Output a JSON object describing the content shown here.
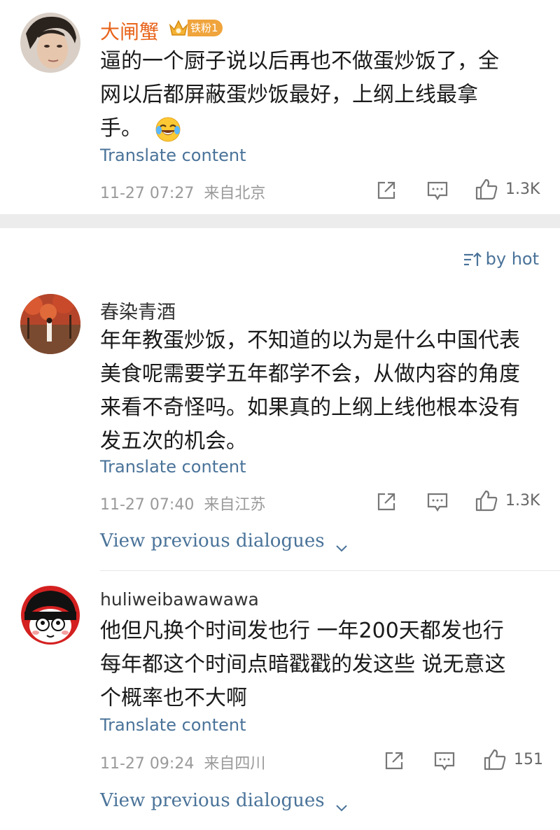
{
  "colors": {
    "link": "#4a7399",
    "username_orange": "#e8641b",
    "meta": "#9a9a9a",
    "gap": "#ececec"
  },
  "top_comment": {
    "username": "大闸蟹",
    "badge_icon": "crown-fan-icon",
    "badge_label": "铁粉1",
    "lines": [
      "逼的一个厨子说以后再也不做蛋炒饭了，全",
      "网以后都屏蔽蛋炒饭最好，上纲上线最拿",
      "手。"
    ],
    "emoji": "laughing-crying-emoji",
    "translate": "Translate content",
    "timestamp": "11-27 07:27",
    "location": "来自北京",
    "likes": "1.3K"
  },
  "sort": {
    "label": "by hot",
    "icon": "sort-icon"
  },
  "comments": [
    {
      "username": "春染青酒",
      "lines": [
        "年年教蛋炒饭，不知道的以为是什么中国代表",
        "美食呢需要学五年都学不会，从做内容的角度",
        "来看不奇怪吗。如果真的上纲上线他根本没有",
        "发五次的机会。"
      ],
      "translate": "Translate content",
      "timestamp": "11-27 07:40",
      "location": "来自江苏",
      "likes": "1.3K",
      "view_previous": "View previous dialogues"
    },
    {
      "username": "huliweibawawawa",
      "lines": [
        "他但凡换个时间发也行 一年200天都发也行",
        "每年都这个时间点暗戳戳的发这些 说无意这",
        "个概率也不大啊"
      ],
      "translate": "Translate content",
      "timestamp": "11-27 09:24",
      "location": "来自四川",
      "likes": "151",
      "view_previous": "View previous dialogues"
    }
  ]
}
